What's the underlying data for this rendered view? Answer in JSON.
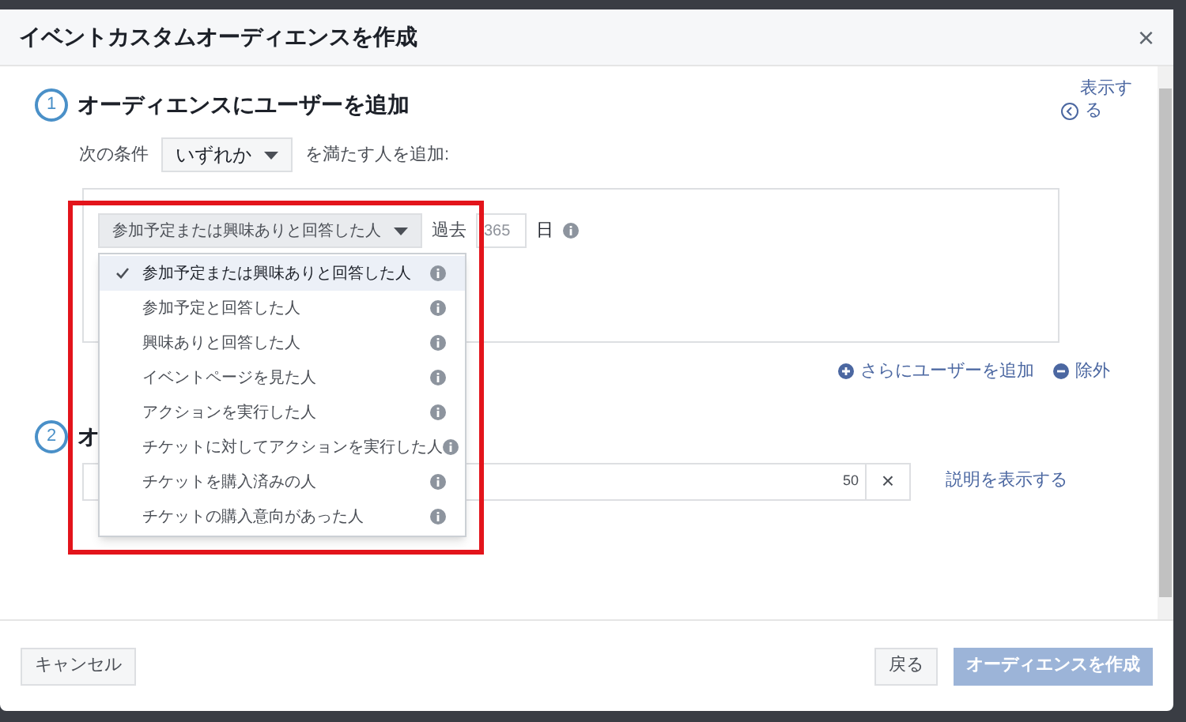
{
  "dialog": {
    "title": "イベントカスタムオーディエンスを作成",
    "close": "×"
  },
  "section1": {
    "step": "1",
    "title": "オーディエンスにユーザーを追加",
    "condition_prefix": "次の条件",
    "condition_select": "いずれか",
    "condition_suffix": "を満たす人を追加:",
    "rule": {
      "selector": "参加予定または興味ありと回答した人",
      "past_label": "過去",
      "days": "365",
      "unit": "日"
    },
    "options": [
      {
        "label": "参加予定または興味ありと回答した人",
        "selected": true
      },
      {
        "label": "参加予定と回答した人",
        "selected": false
      },
      {
        "label": "興味ありと回答した人",
        "selected": false
      },
      {
        "label": "イベントページを見た人",
        "selected": false
      },
      {
        "label": "アクションを実行した人",
        "selected": false
      },
      {
        "label": "チケットに対してアクションを実行した人",
        "selected": false
      },
      {
        "label": "チケットを購入済みの人",
        "selected": false
      },
      {
        "label": "チケットの購入意向があった人",
        "selected": false
      }
    ],
    "add_link": "さらにユーザーを追加",
    "exclude_link": "除外"
  },
  "side_toggle": {
    "lines": [
      "表示す",
      "る"
    ]
  },
  "section2": {
    "step": "2",
    "title": "オ",
    "count": "50",
    "clear": "×",
    "description_link": "説明を表示する"
  },
  "footer": {
    "cancel": "キャンセル",
    "back": "戻る",
    "create": {
      "label": "オーディエンスを作成",
      "disabled": true
    }
  }
}
